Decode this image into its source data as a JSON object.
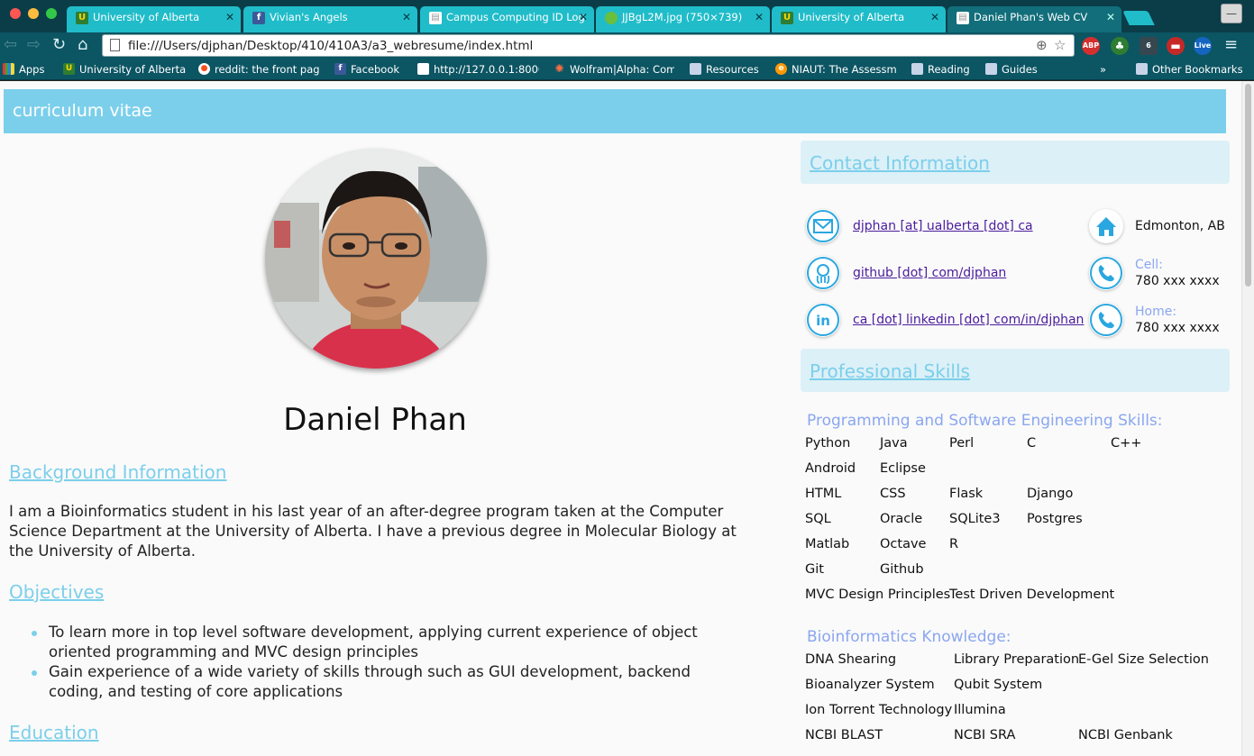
{
  "browser": {
    "tabs": [
      {
        "title": "University of Alberta"
      },
      {
        "title": "Vivian's Angels"
      },
      {
        "title": "Campus Computing ID Log"
      },
      {
        "title": "JJBgL2M.jpg (750×739)"
      },
      {
        "title": "University of Alberta"
      },
      {
        "title": "Daniel Phan's Web CV",
        "active": true
      }
    ],
    "url": "file:///Users/djphan/Desktop/410/410A3/a3_webresume/index.html",
    "extensions": {
      "abp": "ABP",
      "badge": "6",
      "live": "Live"
    },
    "bookmarks": [
      {
        "label": "Apps"
      },
      {
        "label": "University of Alberta"
      },
      {
        "label": "reddit: the front page"
      },
      {
        "label": "Facebook"
      },
      {
        "label": "http://127.0.0.1:8000"
      },
      {
        "label": "Wolfram|Alpha: Comp"
      },
      {
        "label": "Resources"
      },
      {
        "label": "NIAUT: The Assessm"
      },
      {
        "label": "Reading"
      },
      {
        "label": "Guides"
      },
      {
        "label": "»"
      },
      {
        "label": "Other Bookmarks"
      }
    ]
  },
  "page": {
    "header_title": "curriculum vitae",
    "name": "Daniel Phan",
    "background": {
      "title": "Background Information",
      "text": "I am a Bioinformatics student in his last year of an after-degree program taken at the Computer Science Department at the University of Alberta. I have a previous degree in Molecular Biology at the University of Alberta."
    },
    "objectives": {
      "title": "Objectives",
      "items": [
        "To learn more in top level software development, applying current experience of object oriented programming and MVC design principles",
        "Gain experience of a wide variety of skills through such as GUI development, backend coding, and testing of core applications"
      ]
    },
    "education": {
      "title": "Education"
    },
    "contact": {
      "title": "Contact Information",
      "email": "djphan [at] ualberta [dot] ca",
      "github": "github [dot] com/djphan",
      "linkedin": "ca [dot] linkedin [dot] com/in/djphan",
      "location": "Edmonton, AB",
      "cell_label": "Cell:",
      "cell": "780 xxx xxxx",
      "home_label": "Home:",
      "home": "780 xxx xxxx"
    },
    "skills": {
      "title": "Professional Skills",
      "programming_title": "Programming and Software Engineering Skills:",
      "programming": [
        [
          "Python",
          "Java",
          "Perl",
          "C",
          "C++"
        ],
        [
          "Android",
          "Eclipse"
        ],
        [
          "HTML",
          "CSS",
          "Flask",
          "Django"
        ],
        [
          "SQL",
          "Oracle",
          "SQLite3",
          "Postgres"
        ],
        [
          "Matlab",
          "Octave",
          "R"
        ],
        [
          "Git",
          "Github"
        ],
        [
          "MVC Design Principles",
          "Test Driven Development"
        ]
      ],
      "bio_title": "Bioinformatics Knowledge:",
      "bio": [
        [
          "DNA Shearing",
          "Library Preparation",
          "E-Gel Size Selection"
        ],
        [
          "Bioanalyzer System",
          "Qubit System"
        ],
        [
          "Ion Torrent Technology",
          "Illumina"
        ],
        [
          "NCBI BLAST",
          "NCBI SRA",
          "NCBI Genbank"
        ]
      ]
    }
  },
  "colors": {
    "accent": "#7bcfeb",
    "sublabel": "#8aa6f0",
    "link": "#4b1c9c",
    "tab": "#20bcc9"
  }
}
